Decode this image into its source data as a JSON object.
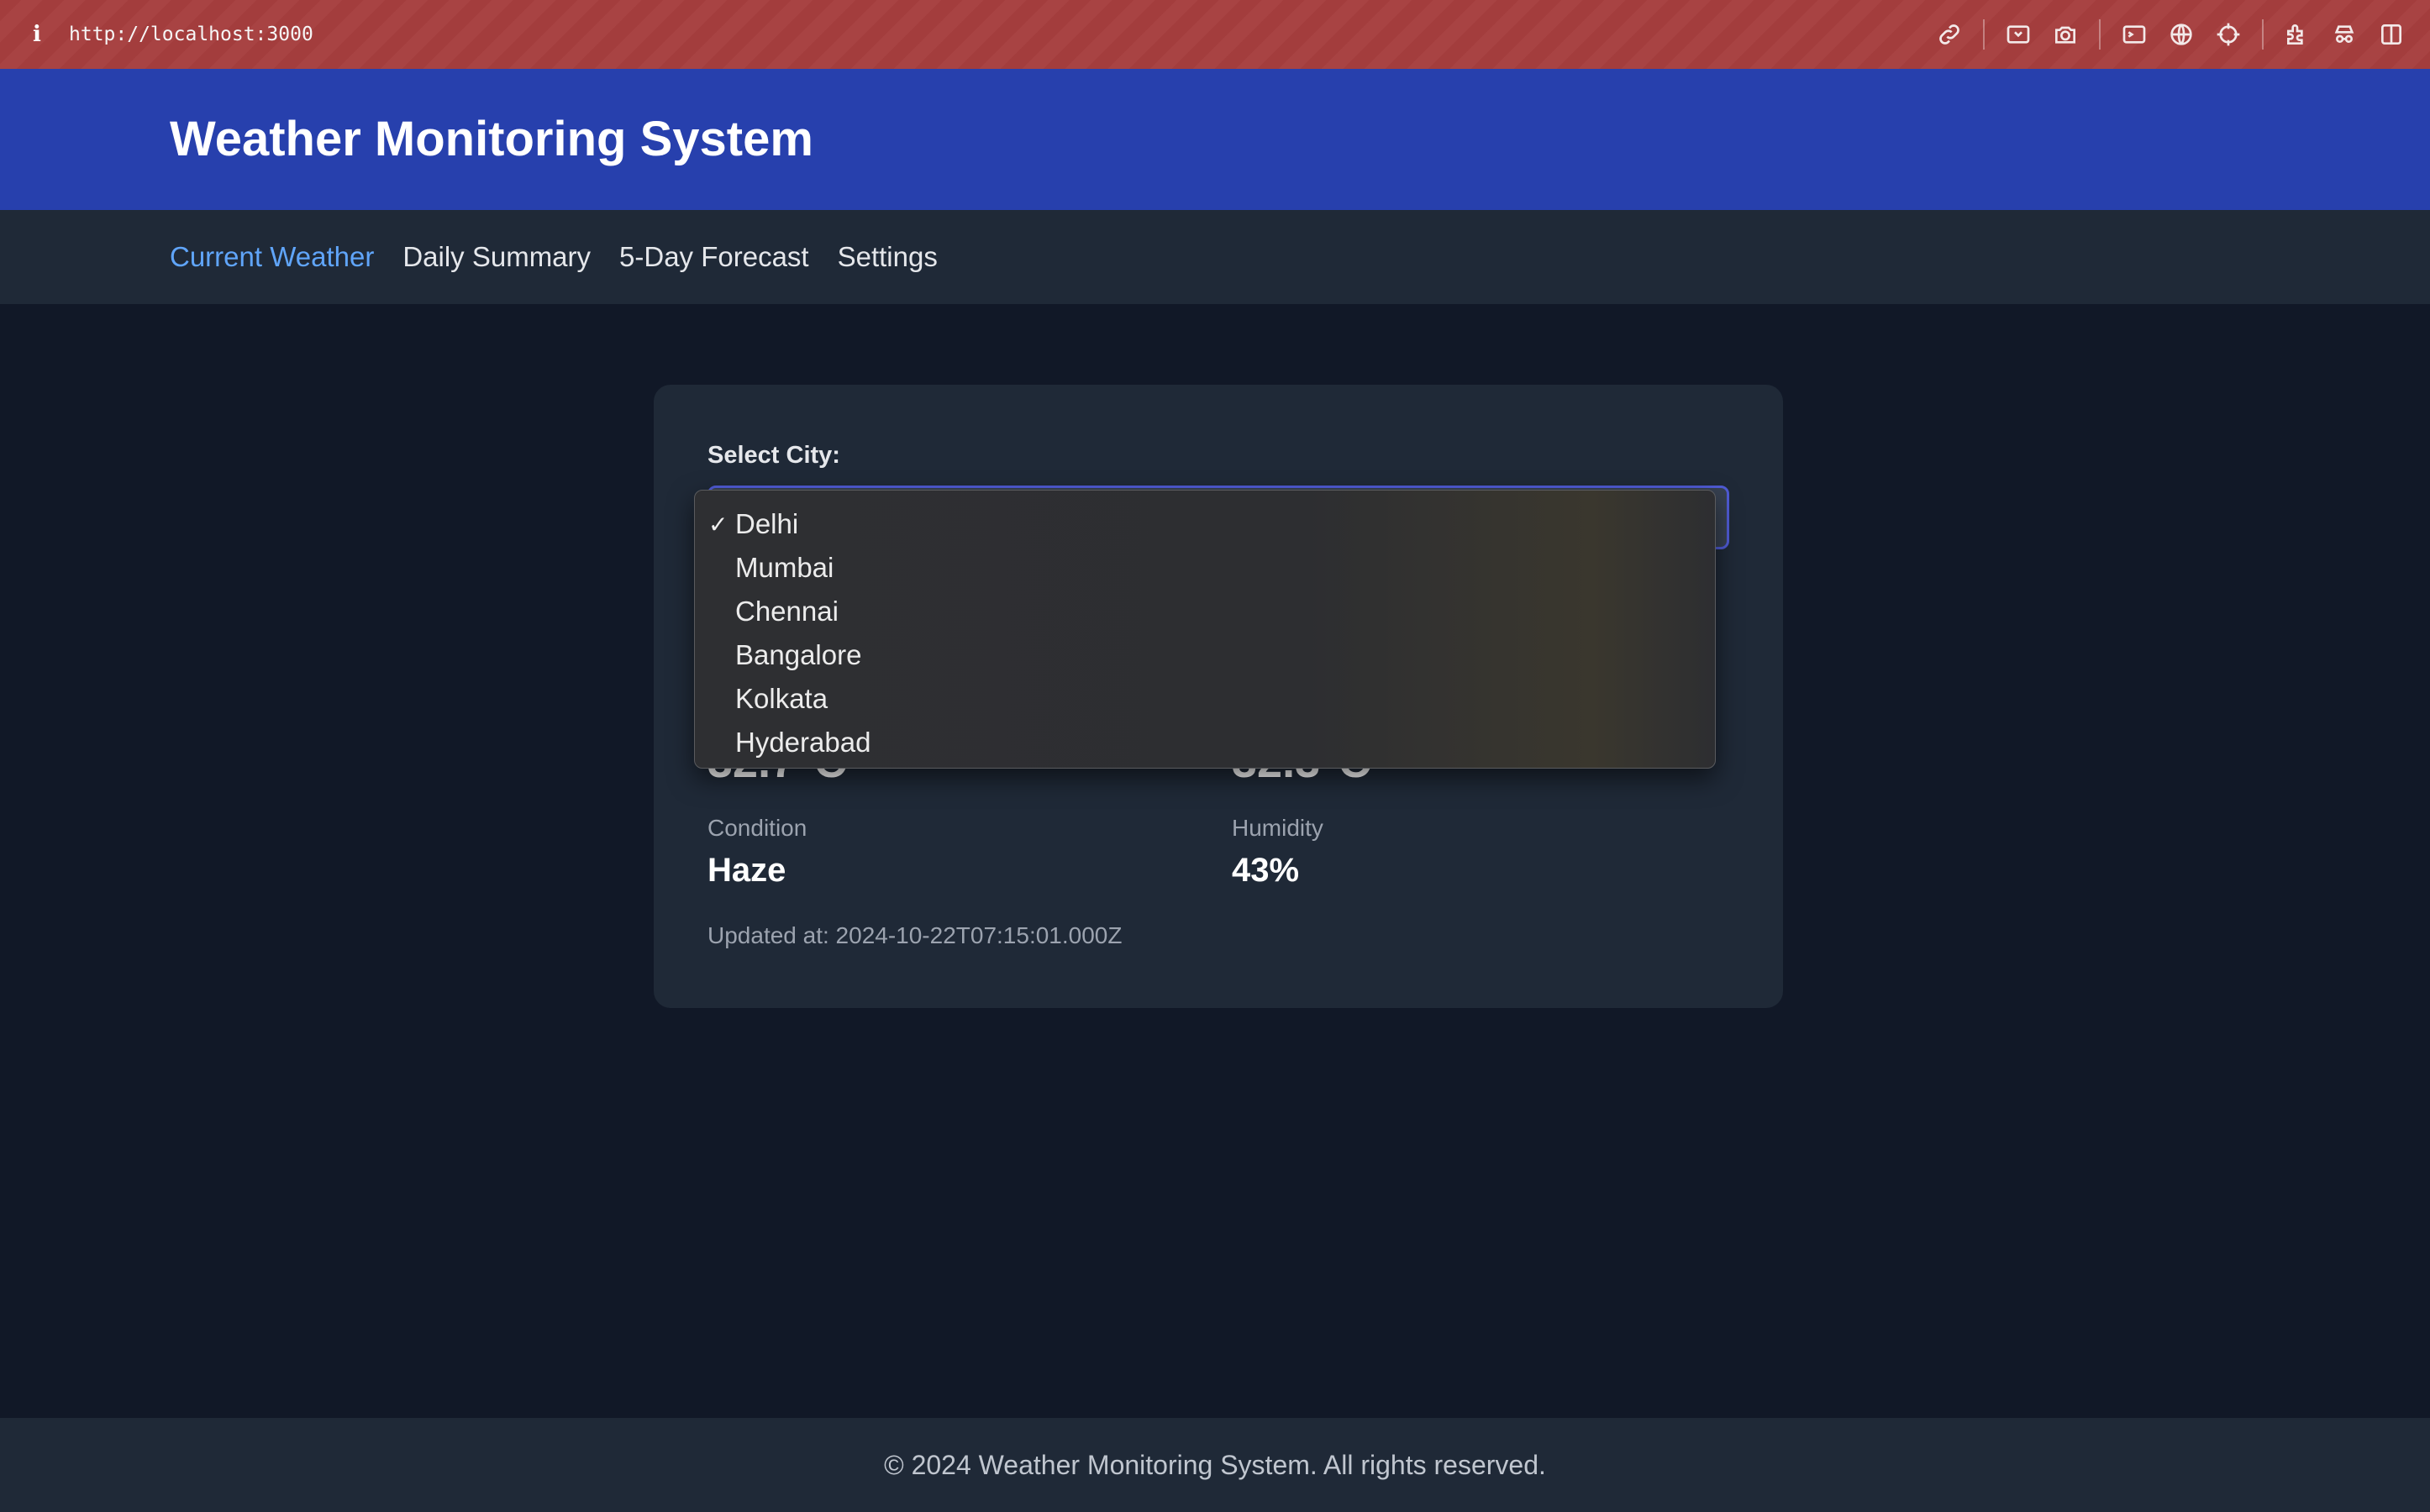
{
  "browser": {
    "url": "http://localhost:3000",
    "info_icon": "i",
    "tools": [
      "link-icon",
      "screenshot-area-icon",
      "camera-icon",
      "terminal-icon",
      "globe-icon",
      "crosshair-icon",
      "extensions-icon",
      "incognito-icon",
      "sidebar-icon"
    ]
  },
  "header": {
    "title": "Weather Monitoring System"
  },
  "nav": {
    "items": [
      {
        "label": "Current Weather",
        "active": true
      },
      {
        "label": "Daily Summary",
        "active": false
      },
      {
        "label": "5-Day Forecast",
        "active": false
      },
      {
        "label": "Settings",
        "active": false
      }
    ]
  },
  "card": {
    "select_label": "Select City:",
    "selected_city": "Delhi",
    "temp_left_partial": "32.7°C",
    "temp_right_partial": "32.3°C",
    "condition_label": "Condition",
    "condition_value": "Haze",
    "humidity_label": "Humidity",
    "humidity_value": "43%",
    "updated": "Updated at: 2024-10-22T07:15:01.000Z"
  },
  "dropdown": {
    "check": "✓",
    "options": [
      "Delhi",
      "Mumbai",
      "Chennai",
      "Bangalore",
      "Kolkata",
      "Hyderabad"
    ]
  },
  "footer": {
    "text": "© 2024 Weather Monitoring System. All rights reserved."
  },
  "colors": {
    "header_bg": "#2740ad",
    "nav_bg": "#1f2937",
    "page_bg": "#111827",
    "active_link": "#60a5fa",
    "chrome_bar": "#a33d3d"
  }
}
